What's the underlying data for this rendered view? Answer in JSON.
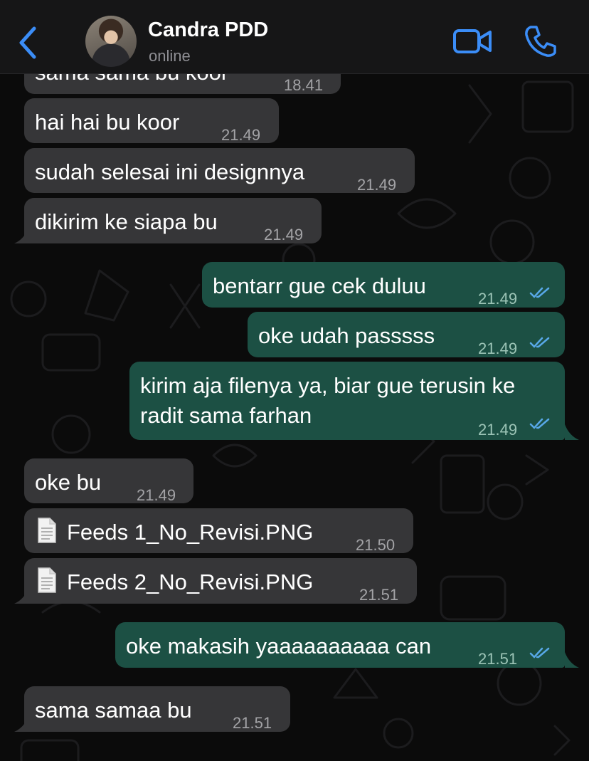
{
  "header": {
    "contact_name": "Candra PDD",
    "status": "online"
  },
  "colors": {
    "accent": "#3b8df7",
    "incoming_bubble": "#363638",
    "outgoing_bubble": "#1c5044",
    "read_ticks": "#58a8e8"
  },
  "icons": {
    "back": "chevron-left-icon",
    "video": "video-camera-icon",
    "call": "phone-icon",
    "attachment": "document-icon",
    "read_receipt": "double-check-icon"
  },
  "messages": [
    {
      "dir": "in",
      "text": "sama sama bu koor",
      "time": "18.41"
    },
    {
      "dir": "in",
      "text": "hai hai bu koor",
      "time": "21.49"
    },
    {
      "dir": "in",
      "text": "sudah selesai ini designnya",
      "time": "21.49"
    },
    {
      "dir": "in",
      "text": "dikirim ke siapa bu",
      "time": "21.49"
    },
    {
      "dir": "out",
      "text": "bentarr gue cek duluu",
      "time": "21.49"
    },
    {
      "dir": "out",
      "text": "oke udah passsss",
      "time": "21.49"
    },
    {
      "dir": "out",
      "text_line1": "kirim aja filenya ya, biar gue terusin ke",
      "text_line2": "radit sama farhan",
      "time": "21.49"
    },
    {
      "dir": "in",
      "text": "oke bu",
      "time": "21.49"
    },
    {
      "dir": "in",
      "file": "Feeds 1_No_Revisi.PNG",
      "time": "21.50"
    },
    {
      "dir": "in",
      "file": "Feeds 2_No_Revisi.PNG",
      "time": "21.51"
    },
    {
      "dir": "out",
      "text": "oke makasih yaaaaaaaaaa can",
      "time": "21.51"
    },
    {
      "dir": "in",
      "text": "sama samaa bu",
      "time": "21.51"
    }
  ]
}
